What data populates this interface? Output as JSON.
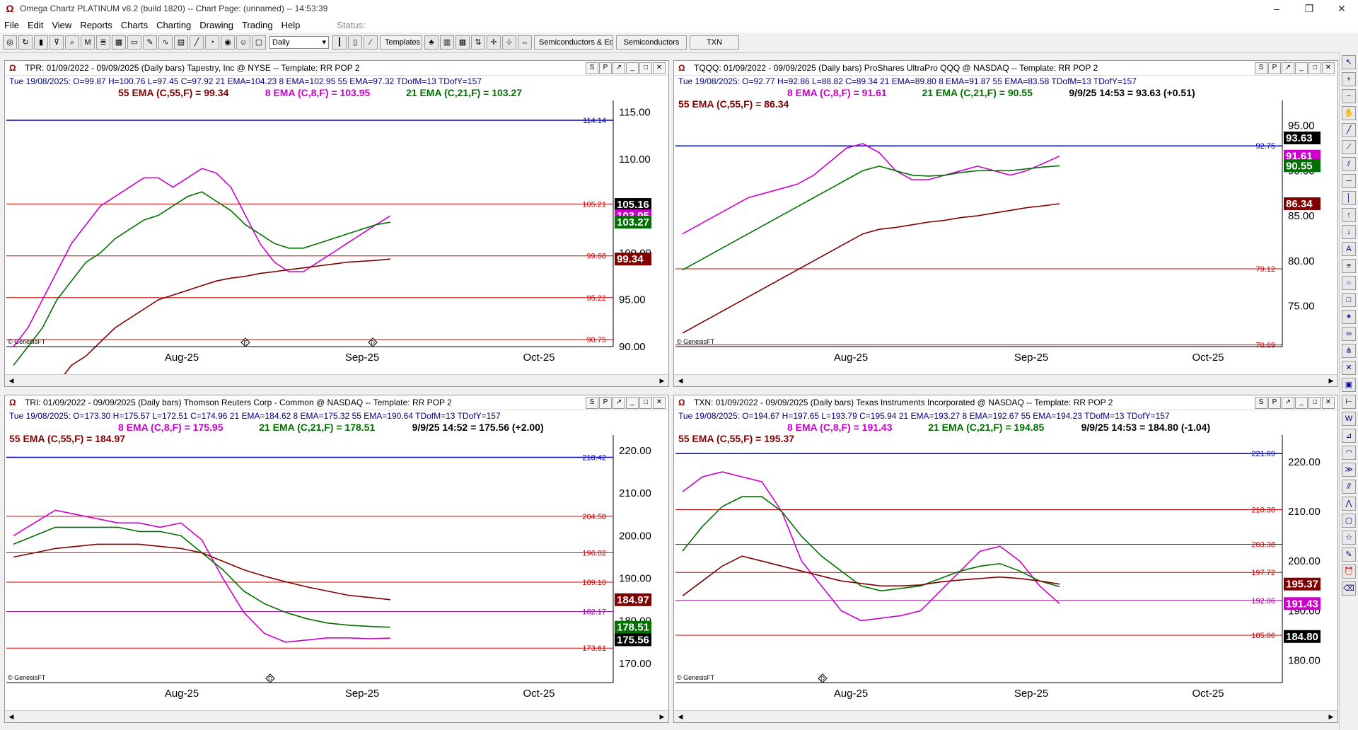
{
  "app": {
    "title": "Omega Chartz PLATINUM v8.2 (build 1820)  --  Chart Page: (unnamed)  --  14:53:39"
  },
  "menu": [
    "File",
    "Edit",
    "View",
    "Reports",
    "Charts",
    "Charting",
    "Drawing",
    "Trading",
    "Help"
  ],
  "status_label": "Status:",
  "toolbar": {
    "period": "Daily",
    "templates": "Templates",
    "tab1": "Semiconductors & Equi",
    "tab2": "Semiconductors",
    "tab3": "TXN"
  },
  "panels": [
    {
      "title": "TPR: 01/09/2022 - 09/09/2025 (Daily bars)  Tapestry, Inc @ NYSE  --  Template: RR POP 2",
      "info": "Tue   19/08/2025:   O=99.87   H=100.76   L=97.45   C=97.92   21 EMA=104.23   8 EMA=102.95   55 EMA=97.32   TDofM=13   TDofY=157",
      "ema_line1": [
        {
          "text": "55 EMA (C,55,F) = 99.34",
          "color": "#800000"
        },
        {
          "text": "8 EMA (C,8,F) = 103.95",
          "color": "#cc00cc"
        },
        {
          "text": "21 EMA (C,21,F) = 103.27",
          "color": "#007000"
        }
      ],
      "ema_line2": [],
      "ylim": [
        90,
        115.5
      ],
      "ticks": [
        "90.00",
        "95.00",
        "100.00",
        "105.00",
        "110.00",
        "115.00"
      ],
      "hlines": [
        {
          "v": 114.14,
          "label": "114.14",
          "color": "#0000c0"
        },
        {
          "v": 105.21,
          "label": "105.21",
          "color": "#d00000"
        },
        {
          "v": 99.68,
          "label": "99.68",
          "color": "#d00000"
        },
        {
          "v": 95.22,
          "label": "95.22",
          "color": "#d00000"
        },
        {
          "v": 90.75,
          "label": "90.75",
          "color": "#d00000"
        }
      ],
      "badges": [
        {
          "v": 105.16,
          "label": "105.16",
          "bg": "#000000"
        },
        {
          "v": 103.95,
          "label": "103.95",
          "bg": "#cc00cc"
        },
        {
          "v": 103.27,
          "label": "103.27",
          "bg": "#007000"
        },
        {
          "v": 99.34,
          "label": "99.34",
          "bg": "#800000"
        }
      ],
      "xlabels": [
        "Aug-25",
        "Sep-25",
        "Oct-25"
      ],
      "markers": [
        "E",
        "D"
      ],
      "watermark": "© GenesisFT"
    },
    {
      "title": "TQQQ: 01/09/2022 - 09/09/2025 (Daily bars)  ProShares UltraPro QQQ @ NASDAQ  --  Template: RR POP 2",
      "info": "Tue   19/08/2025:   O=92.77   H=92.86   L=88.82   C=89.34   21 EMA=89.80   8 EMA=91.87   55 EMA=83.58   TDofM=13   TDofY=157",
      "ema_line1": [
        {
          "text": "8 EMA (C,8,F) = 91.61",
          "color": "#cc00cc"
        },
        {
          "text": "21 EMA (C,21,F) = 90.55",
          "color": "#007000"
        },
        {
          "text": "9/9/25 14:53 = 93.63 (+0.51)",
          "color": "#000000"
        }
      ],
      "ema_line2": [
        {
          "text": "55 EMA (C,55,F) = 86.34",
          "color": "#800000"
        }
      ],
      "ylim": [
        70.5,
        97
      ],
      "ticks": [
        "75.00",
        "80.00",
        "85.00",
        "90.00",
        "95.00"
      ],
      "hlines": [
        {
          "v": 92.75,
          "label": "92.75",
          "color": "#0000c0"
        },
        {
          "v": 79.12,
          "label": "79.12",
          "color": "#d00000"
        },
        {
          "v": 70.69,
          "label": "70.69",
          "color": "#d00000"
        }
      ],
      "badges": [
        {
          "v": 93.63,
          "label": "93.63",
          "bg": "#000000"
        },
        {
          "v": 91.61,
          "label": "91.61",
          "bg": "#cc00cc"
        },
        {
          "v": 90.55,
          "label": "90.55",
          "bg": "#007000"
        },
        {
          "v": 86.34,
          "label": "86.34",
          "bg": "#800000"
        }
      ],
      "xlabels": [
        "Aug-25",
        "Sep-25",
        "Oct-25"
      ],
      "markers": [],
      "watermark": "© GenesisFT"
    },
    {
      "title": "TRI: 01/09/2022 - 09/09/2025 (Daily bars)  Thomson Reuters Corp - Common @ NASDAQ  --  Template: RR POP 2",
      "info": "Tue   19/08/2025:   O=173.30   H=175.57   L=172.51   C=174.96   21 EMA=184.62   8 EMA=175.32   55 EMA=190.64   TDofM=13   TDofY=157",
      "ema_line1": [
        {
          "text": "8 EMA (C,8,F) = 175.95",
          "color": "#cc00cc"
        },
        {
          "text": "21 EMA (C,21,F) = 178.51",
          "color": "#007000"
        },
        {
          "text": "9/9/25 14:52 = 175.56 (+2.00)",
          "color": "#000000"
        }
      ],
      "ema_line2": [
        {
          "text": "55 EMA (C,55,F) = 184.97",
          "color": "#800000"
        }
      ],
      "ylim": [
        165.5,
        222
      ],
      "ticks": [
        "170.00",
        "180.00",
        "190.00",
        "200.00",
        "210.00",
        "220.00"
      ],
      "hlines": [
        {
          "v": 218.42,
          "label": "218.42",
          "color": "#0000c0"
        },
        {
          "v": 204.58,
          "label": "204.58",
          "color": "#d00000"
        },
        {
          "v": 196.02,
          "label": "196.02",
          "color": "#d00000"
        },
        {
          "v": 189.1,
          "label": "189.10",
          "color": "#d00000"
        },
        {
          "v": 182.17,
          "label": "182.17",
          "color": "#990099"
        },
        {
          "v": 173.61,
          "label": "173.61",
          "color": "#d00000"
        }
      ],
      "badges": [
        {
          "v": 184.97,
          "label": "184.97",
          "bg": "#800000"
        },
        {
          "v": 178.51,
          "label": "178.51",
          "bg": "#007000"
        },
        {
          "v": 175.56,
          "label": "175.56",
          "bg": "#000000"
        }
      ],
      "xlabels": [
        "Aug-25",
        "Sep-25",
        "Oct-25"
      ],
      "markers": [
        "D"
      ],
      "watermark": "© GenesisFT"
    },
    {
      "title": "TXN: 01/09/2022 - 09/09/2025 (Daily bars)  Texas Instruments Incorporated @ NASDAQ  --  Template: RR POP 2",
      "info": "Tue   19/08/2025:   O=194.67   H=197.65   L=193.79   C=195.94   21 EMA=193.27   8 EMA=192.67   55 EMA=194.23   TDofM=13   TDofY=157",
      "ema_line1": [
        {
          "text": "8 EMA (C,8,F) = 191.43",
          "color": "#cc00cc"
        },
        {
          "text": "21 EMA (C,21,F) = 194.85",
          "color": "#007000"
        },
        {
          "text": "9/9/25 14:53 = 184.80 (-1.04)",
          "color": "#000000"
        }
      ],
      "ema_line2": [
        {
          "text": "55 EMA (C,55,F) = 195.37",
          "color": "#800000"
        }
      ],
      "ylim": [
        175.5,
        224
      ],
      "ticks": [
        "180.00",
        "190.00",
        "200.00",
        "210.00",
        "220.00"
      ],
      "hlines": [
        {
          "v": 221.69,
          "label": "221.69",
          "color": "#0000c0"
        },
        {
          "v": 210.38,
          "label": "210.38",
          "color": "#d00000"
        },
        {
          "v": 203.38,
          "label": "203.38",
          "color": "#d00000"
        },
        {
          "v": 197.72,
          "label": "197.72",
          "color": "#d00000"
        },
        {
          "v": 192.06,
          "label": "192.06",
          "color": "#990099"
        },
        {
          "v": 185.06,
          "label": "185.06",
          "color": "#d00000"
        }
      ],
      "badges": [
        {
          "v": 195.37,
          "label": "195.37",
          "bg": "#800000"
        },
        {
          "v": 191.43,
          "label": "191.43",
          "bg": "#cc00cc"
        },
        {
          "v": 184.8,
          "label": "184.80",
          "bg": "#000000"
        }
      ],
      "xlabels": [
        "Aug-25",
        "Sep-25",
        "Oct-25"
      ],
      "markers": [
        "D"
      ],
      "watermark": "© GenesisFT"
    }
  ],
  "chart_data": [
    {
      "type": "line",
      "title": "TPR",
      "series": [
        {
          "name": "8 EMA",
          "values": [
            90,
            92,
            95,
            98,
            101,
            103,
            105,
            106,
            107,
            108,
            108,
            107,
            108,
            109,
            108.5,
            107,
            104,
            101,
            99,
            98,
            98,
            99,
            100,
            101,
            102,
            103,
            103.95
          ]
        },
        {
          "name": "21 EMA",
          "values": [
            88,
            90,
            92,
            95,
            97,
            99,
            100,
            101.5,
            102.5,
            103.5,
            104,
            105,
            106,
            106.5,
            105.5,
            104.5,
            103,
            102,
            101,
            100.5,
            100.5,
            101,
            101.5,
            102,
            102.5,
            103,
            103.27
          ]
        },
        {
          "name": "55 EMA",
          "values": [
            80,
            82,
            84,
            86,
            88,
            89,
            90.5,
            92,
            93,
            94,
            95,
            95.5,
            96,
            96.5,
            97,
            97.3,
            97.5,
            97.8,
            98,
            98.2,
            98.4,
            98.6,
            98.8,
            99,
            99.1,
            99.2,
            99.34
          ]
        }
      ]
    },
    {
      "type": "line",
      "title": "TQQQ",
      "series": [
        {
          "name": "8 EMA",
          "values": [
            83,
            84,
            85,
            86,
            87,
            87.5,
            88,
            88.5,
            89.5,
            91,
            92.5,
            93,
            92,
            90,
            89,
            89,
            89.5,
            90,
            90.5,
            90,
            89.5,
            90,
            90.8,
            91.61
          ]
        },
        {
          "name": "21 EMA",
          "values": [
            79,
            80,
            81,
            82,
            83,
            84,
            85,
            86,
            87,
            88,
            89,
            90,
            90.5,
            90,
            89.5,
            89.4,
            89.5,
            89.8,
            90,
            90,
            90,
            90.2,
            90.4,
            90.55
          ]
        },
        {
          "name": "55 EMA",
          "values": [
            72,
            73,
            74,
            75,
            76,
            77,
            78,
            79,
            80,
            81,
            82,
            83,
            83.5,
            83.7,
            84,
            84.3,
            84.5,
            84.8,
            85,
            85.3,
            85.6,
            85.9,
            86.1,
            86.34
          ]
        }
      ]
    },
    {
      "type": "line",
      "title": "TRI",
      "series": [
        {
          "name": "8 EMA",
          "values": [
            200,
            203,
            206,
            205,
            204,
            203,
            203,
            202,
            203,
            199,
            190,
            182,
            177,
            175,
            175.5,
            176,
            176,
            175.8,
            175.95
          ]
        },
        {
          "name": "21 EMA",
          "values": [
            198,
            200,
            202,
            202,
            202,
            202,
            201,
            201,
            200,
            196,
            192,
            187,
            184,
            182,
            180.5,
            179.5,
            179,
            178.7,
            178.51
          ]
        },
        {
          "name": "55 EMA",
          "values": [
            195,
            196,
            197,
            197.5,
            198,
            198,
            198,
            197.5,
            197,
            196,
            194,
            192,
            190.5,
            189.2,
            188,
            187,
            186,
            185.5,
            184.97
          ]
        }
      ]
    },
    {
      "type": "line",
      "title": "TXN",
      "series": [
        {
          "name": "8 EMA",
          "values": [
            214,
            217,
            218,
            217,
            216,
            210,
            200,
            195,
            190,
            188,
            188.5,
            189,
            190,
            194,
            198,
            202,
            203,
            200,
            195,
            191.43
          ]
        },
        {
          "name": "21 EMA",
          "values": [
            202,
            207,
            211,
            213,
            213,
            210,
            205,
            201,
            198,
            195,
            194,
            194.5,
            195,
            196.5,
            198,
            199,
            199.5,
            198,
            196,
            194.85
          ]
        },
        {
          "name": "55 EMA",
          "values": [
            193,
            196,
            199,
            201,
            200,
            199,
            198,
            197,
            196,
            195.5,
            195,
            195,
            195.2,
            195.8,
            196.2,
            196.5,
            196.8,
            196.5,
            196,
            195.37
          ]
        }
      ]
    }
  ]
}
